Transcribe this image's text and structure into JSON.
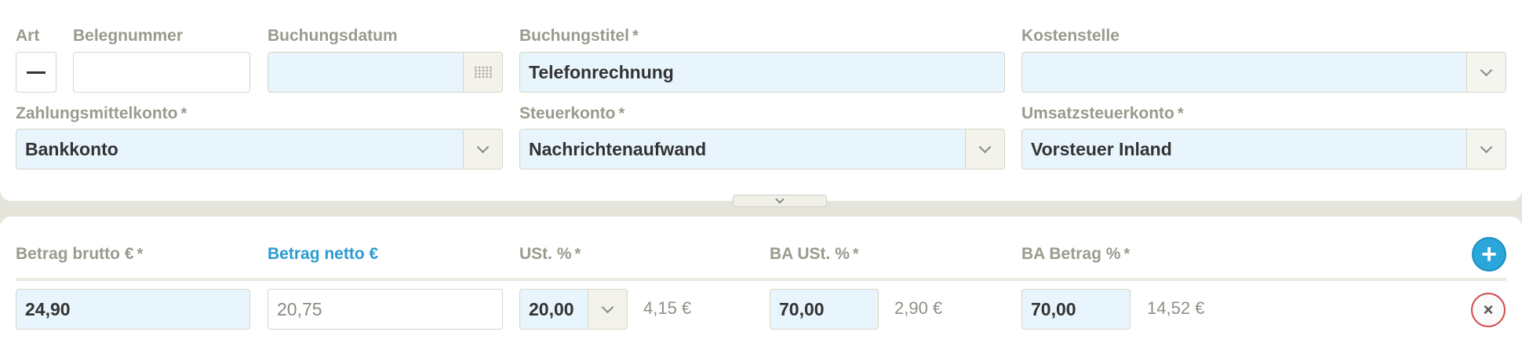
{
  "header": {
    "art_label": "Art",
    "belegnummer_label": "Belegnummer",
    "buchungsdatum_label": "Buchungsdatum",
    "buchungstitel_label": "Buchungstitel",
    "kostenstelle_label": "Kostenstelle",
    "zahlungsmittelkonto_label": "Zahlungsmittelkonto",
    "steuerkonto_label": "Steuerkonto",
    "umsatzsteuerkonto_label": "Umsatzsteuerkonto",
    "required_mark": "*"
  },
  "fields": {
    "art_symbol": "minus",
    "belegnummer_value": "",
    "buchungsdatum_value": "",
    "buchungstitel_value": "Telefonrechnung",
    "kostenstelle_value": "",
    "zahlungsmittelkonto_value": "Bankkonto",
    "steuerkonto_value": "Nachrichtenaufwand",
    "umsatzsteuerkonto_value": "Vorsteuer Inland"
  },
  "amounts": {
    "betrag_brutto_label": "Betrag brutto €",
    "betrag_netto_label": "Betrag netto €",
    "ust_label": "USt. %",
    "ba_ust_label": "BA USt. %",
    "ba_betrag_label": "BA Betrag %",
    "required_mark": "*",
    "row": {
      "betrag_brutto": "24,90",
      "betrag_netto": "20,75",
      "ust_percent": "20,00",
      "ust_amount": "4,15 €",
      "ba_ust_percent": "70,00",
      "ba_ust_amount": "2,90 €",
      "ba_betrag_percent": "70,00",
      "ba_betrag_amount": "14,52 €"
    },
    "add_symbol": "+",
    "remove_symbol": "×"
  },
  "icons": {
    "calendar": "calendar-icon",
    "dropdown": "chevron-down-icon",
    "collapse": "chevron-down-icon",
    "add": "plus-icon",
    "remove": "close-icon"
  },
  "colors": {
    "field_bg": "#e8f5fc",
    "label": "#9a9a8e",
    "accent_blue": "#2a9bd1",
    "remove_red": "#d24a4a"
  }
}
